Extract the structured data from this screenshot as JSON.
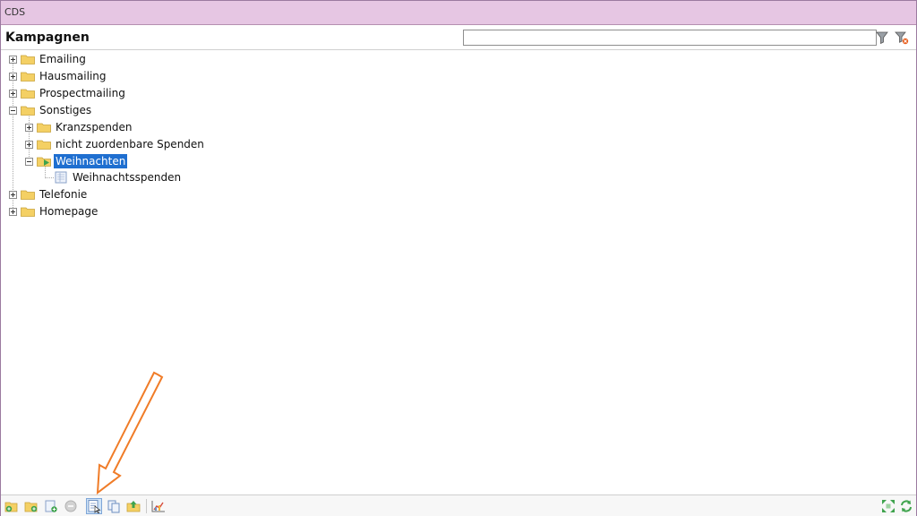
{
  "window": {
    "title": "CDS"
  },
  "panel": {
    "title": "Kampagnen",
    "search_value": ""
  },
  "icons": {
    "filter": "filter-icon",
    "clear_filter": "filter-clear-icon",
    "folder": "folder-icon",
    "open_folder": "open-folder-icon",
    "document": "document-icon",
    "expand_all": "expand-all-icon",
    "refresh": "refresh-icon"
  },
  "tree": {
    "emailing": "Emailing",
    "hausmailing": "Hausmailing",
    "prospectmailing": "Prospectmailing",
    "sonstiges": "Sonstiges",
    "kranzspenden": "Kranzspenden",
    "nicht_zuordenbare": "nicht zuordenbare Spenden",
    "weihnachten": "Weihnachten",
    "weihnachtsspenden": "Weihnachtsspenden",
    "telefonie": "Telefonie",
    "homepage": "Homepage"
  },
  "colors": {
    "titlebar": "#e6c6e3",
    "selection": "#1f6fd0",
    "annotation_arrow": "#f07c28"
  }
}
